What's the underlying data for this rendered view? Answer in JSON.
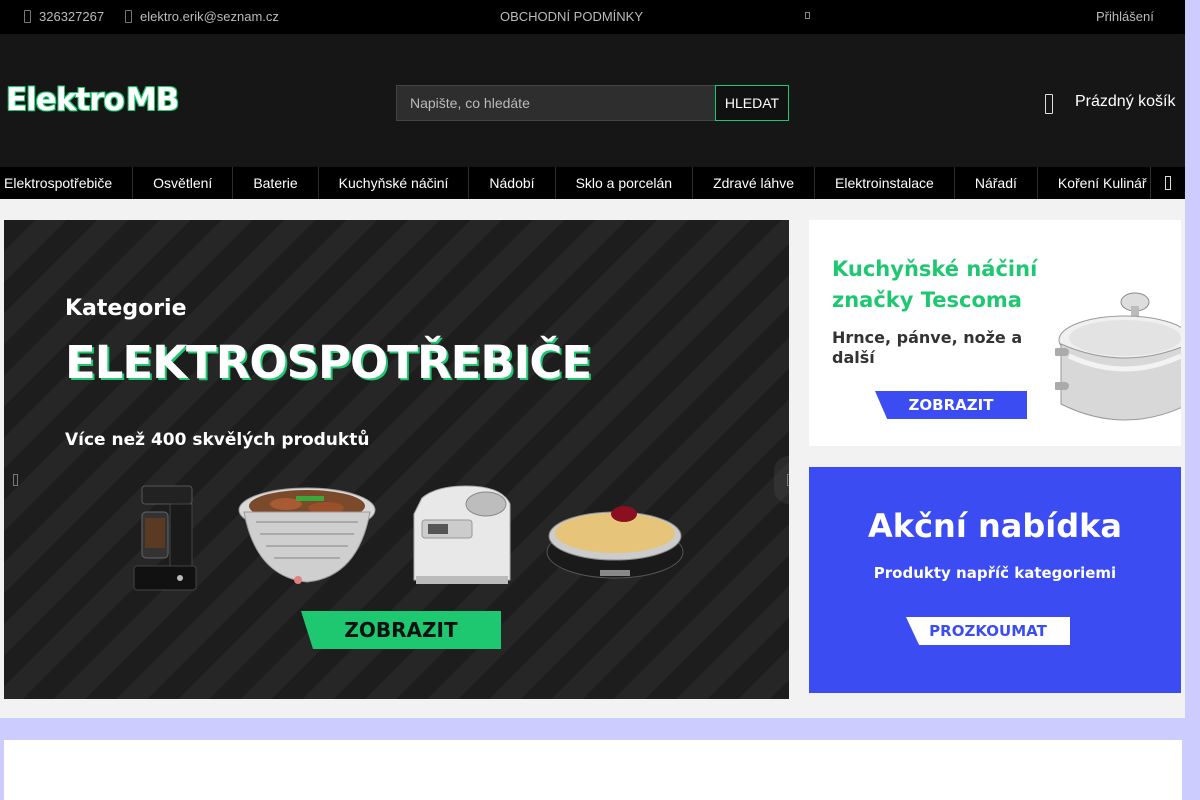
{
  "topbar": {
    "phone": "326327267",
    "email": "elektro.erik@seznam.cz",
    "terms": "OBCHODNÍ PODMÍNKY",
    "login": "Přihlášení",
    "icons": [
      "phone-icon",
      "mail-icon",
      "expand-icon"
    ]
  },
  "header": {
    "logo_part1": "Elektro",
    "logo_part2": "MB",
    "search_placeholder": "Napište, co hledáte",
    "search_button": "HLEDAT",
    "cart_label": "Prázdný košík",
    "cart_icon": "cart-icon"
  },
  "nav": {
    "items": [
      {
        "label": "Elektrospotřebiče"
      },
      {
        "label": "Osvětlení"
      },
      {
        "label": "Baterie"
      },
      {
        "label": "Kuchyňské náčiní"
      },
      {
        "label": "Nádobí"
      },
      {
        "label": "Sklo a porcelán"
      },
      {
        "label": "Zdravé láhve"
      },
      {
        "label": "Elektroinstalace"
      },
      {
        "label": "Nářadí"
      },
      {
        "label": "Koření Kulinář"
      }
    ],
    "more_icon": "menu-more-icon"
  },
  "slider": {
    "kicker": "Kategorie",
    "title": "ELEKTROSPOTŘEBIČE",
    "subtitle": "Více než 400 skvělých produktů",
    "button": "ZOBRAZIT",
    "product_icons": [
      "coffee-maker-icon",
      "grill-icon",
      "ice-cream-maker-icon",
      "crepe-maker-icon"
    ]
  },
  "banner_tescoma": {
    "title": "Kuchyňské náčiní značky Tescoma",
    "subtitle": "Hrnce, pánve, nože a další",
    "button": "ZOBRAZIT",
    "image_icon": "pot-icon"
  },
  "banner_promo": {
    "title": "Akční nabídka",
    "subtitle": "Produkty napříč kategoriemi",
    "button": "PROZKOUMAT"
  },
  "colors": {
    "accent_green": "#1ec870",
    "accent_blue": "#3b4df2",
    "header_bg": "#161616",
    "nav_bg": "#000000",
    "page_bg": "#ccccff"
  }
}
